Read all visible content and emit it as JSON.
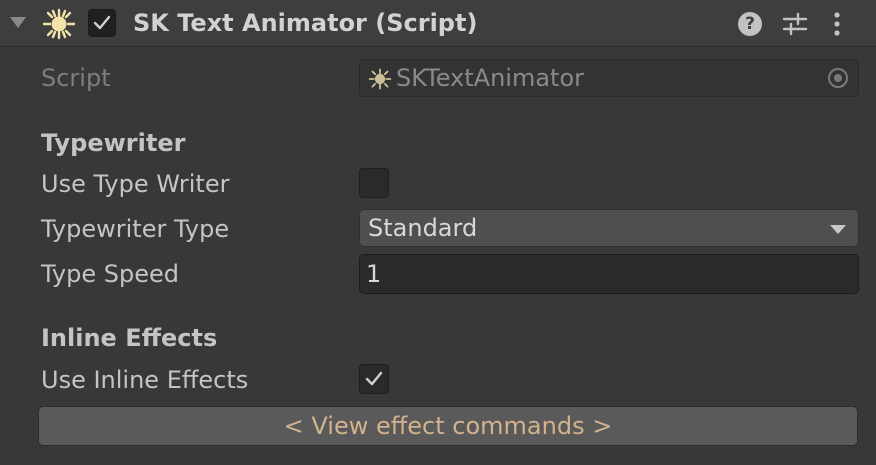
{
  "component": {
    "title": "SK Text Animator (Script)",
    "enabled": true,
    "help_symbol": "?"
  },
  "script_field": {
    "label": "Script",
    "value": "SKTextAnimator"
  },
  "typewriter": {
    "heading": "Typewriter",
    "use_type_writer": {
      "label": "Use Type Writer",
      "checked": false
    },
    "typewriter_type": {
      "label": "Typewriter Type",
      "value": "Standard"
    },
    "type_speed": {
      "label": "Type Speed",
      "value": "1"
    }
  },
  "inline_effects": {
    "heading": "Inline Effects",
    "use_inline_effects": {
      "label": "Use Inline Effects",
      "checked": true
    }
  },
  "view_commands_button": "< View effect commands >",
  "icons": [
    "foldout-arrow-icon",
    "sun-script-icon",
    "checkmark-icon",
    "help-icon",
    "preset-sliders-icon",
    "kebab-menu-icon",
    "object-picker-icon",
    "dropdown-arrow-icon"
  ],
  "colors": {
    "background": "#383838",
    "header": "#3e3e3e",
    "button_text": "#d3b28e",
    "sun_icon": "#f2e4a8"
  }
}
